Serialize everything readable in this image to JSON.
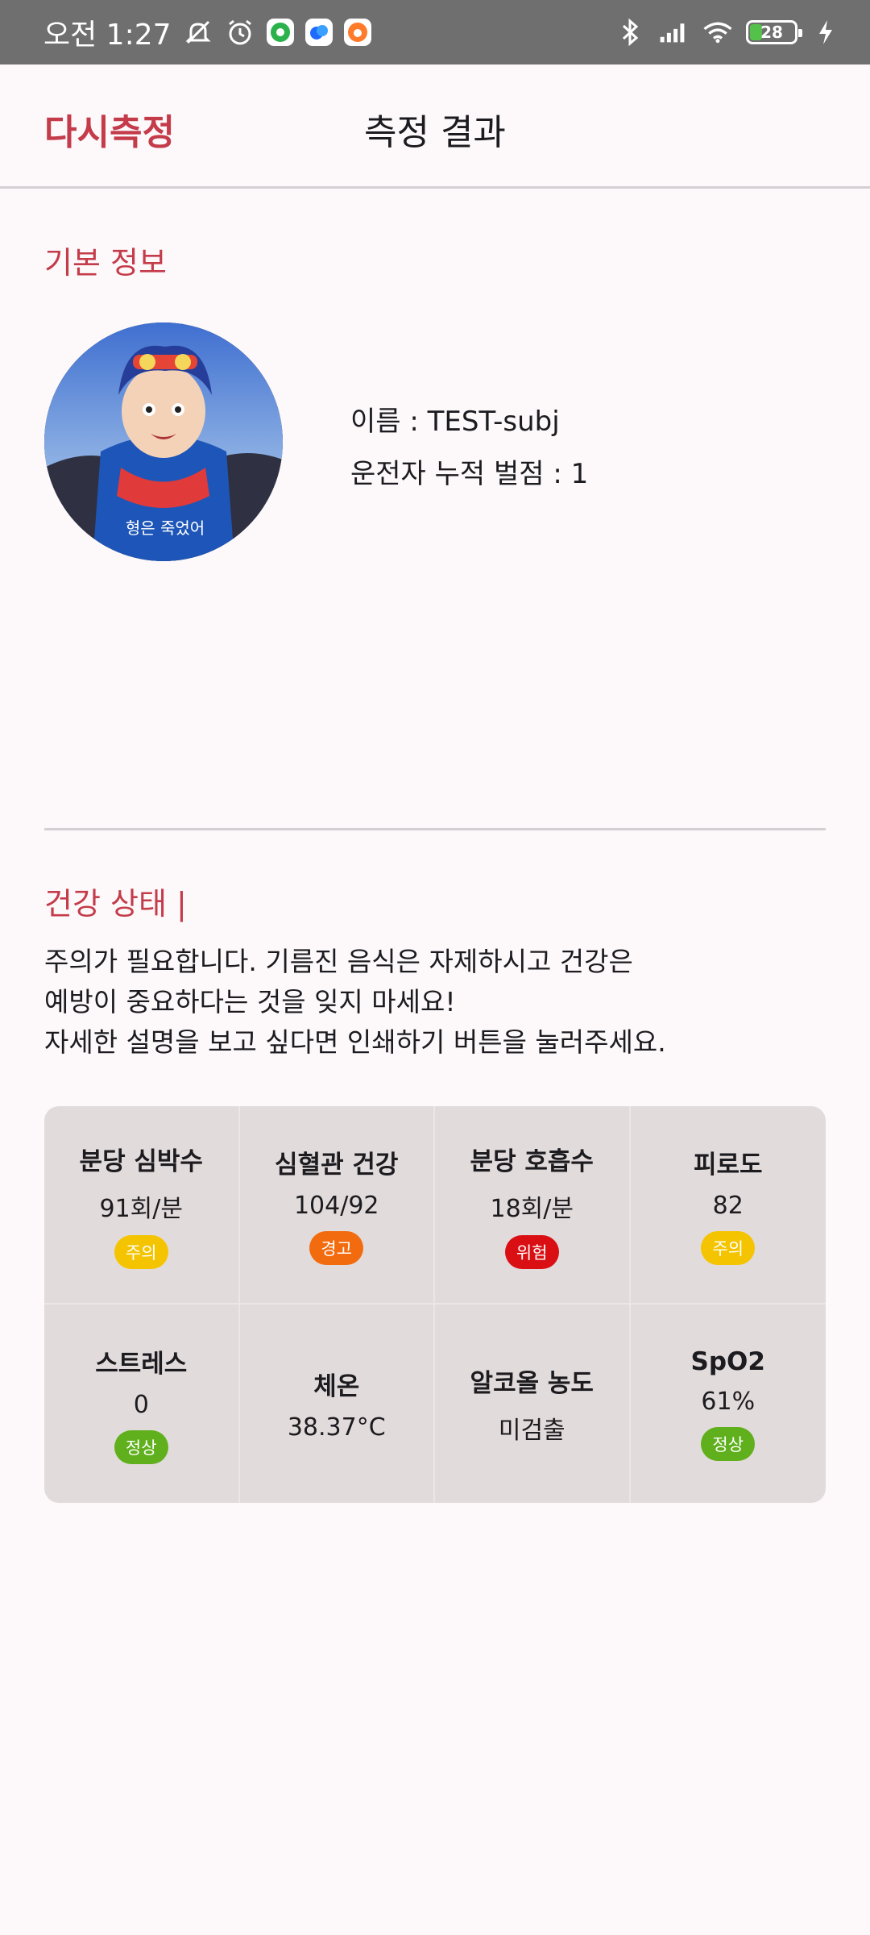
{
  "status_bar": {
    "time": "오전 1:27",
    "battery": "28",
    "icons": [
      "mute-icon",
      "alarm-icon",
      "green-app-icon",
      "blue-app-icon",
      "orange-app-icon",
      "bluetooth-icon",
      "signal-icon",
      "wifi-icon",
      "battery-icon",
      "charging-icon"
    ],
    "battery_level_percent": 28
  },
  "header": {
    "retest_label": "다시측정",
    "title": "측정 결과"
  },
  "basic_info": {
    "title": "기본 정보",
    "avatar_caption": "형은 죽었어",
    "name_line": "이름 : TEST-subj",
    "penalty_line": "운전자 누적 벌점 : 1"
  },
  "health": {
    "title": "건강 상태 |",
    "message_lines": [
      "주의가 필요합니다. 기름진 음식은 자제하시고 건강은",
      "예방이 중요하다는 것을 잊지 마세요!",
      "자세한 설명을 보고 싶다면 인쇄하기 버튼을 눌러주세요."
    ]
  },
  "metrics": [
    {
      "label": "분당 심박수",
      "value": "91회/분",
      "status": "주의",
      "status_color": "#f5c400"
    },
    {
      "label": "심혈관 건강",
      "value": "104/92",
      "status": "경고",
      "status_color": "#f26b0f"
    },
    {
      "label": "분당 호흡수",
      "value": "18회/분",
      "status": "위험",
      "status_color": "#d90f14"
    },
    {
      "label": "피로도",
      "value": "82",
      "status": "주의",
      "status_color": "#f5c400"
    },
    {
      "label": "스트레스",
      "value": "0",
      "status": "정상",
      "status_color": "#5fb01c"
    },
    {
      "label": "체온",
      "value": "38.37°C",
      "status": "",
      "status_color": ""
    },
    {
      "label": "알코올 농도",
      "value": "미검출",
      "status": "",
      "status_color": ""
    },
    {
      "label": "SpO2",
      "value": "61%",
      "status": "정상",
      "status_color": "#5fb01c"
    }
  ],
  "colors": {
    "accent": "#c43b4a",
    "background": "#fdf9fb",
    "grid_bg": "#e2dbdb",
    "status_bar": "#6f6f6f"
  }
}
